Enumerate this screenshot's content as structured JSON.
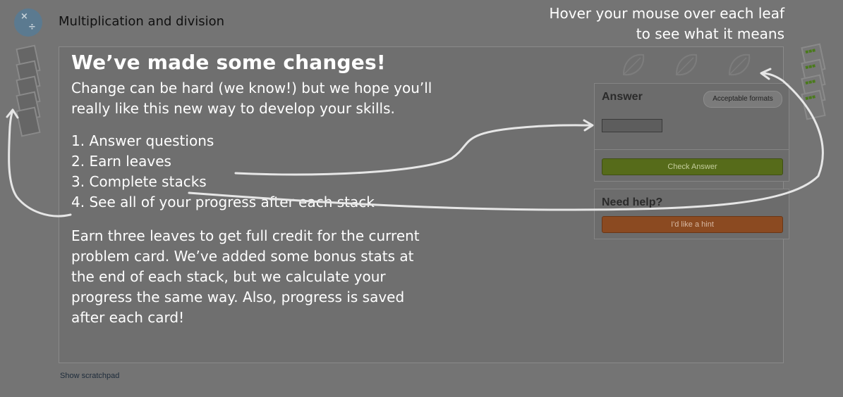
{
  "header": {
    "title": "Multiplication and division",
    "topic_icon_glyphs": [
      "×",
      "÷"
    ]
  },
  "hover_hint": {
    "line1": "Hover your mouse over each leaf",
    "line2": "to see what it means"
  },
  "intro": {
    "heading": "We’ve made some changes!",
    "paragraph1": "Change can be hard (we know!) but we hope you’ll really like this new way to develop your skills.",
    "steps": [
      "1. Answer questions",
      "2. Earn leaves",
      "3. Complete stacks",
      "4. See all of your progress after each stack"
    ],
    "paragraph2": "Earn three leaves to get full credit for the current problem card. We’ve added some bonus stats at the end of each stack, but we calculate your progress the same way. Also, progress is saved after each card!"
  },
  "answer": {
    "title": "Answer",
    "formats_label": "Acceptable formats",
    "input_value": "",
    "check_label": "Check Answer"
  },
  "help": {
    "title": "Need help?",
    "hint_label": "I'd like a hint"
  },
  "footer": {
    "scratchpad_label": "Show scratchpad"
  },
  "colors": {
    "overlay": "#747474",
    "check_button": "#566b1a",
    "hint_button": "#8b4a21",
    "arrow": "#ffffff"
  }
}
